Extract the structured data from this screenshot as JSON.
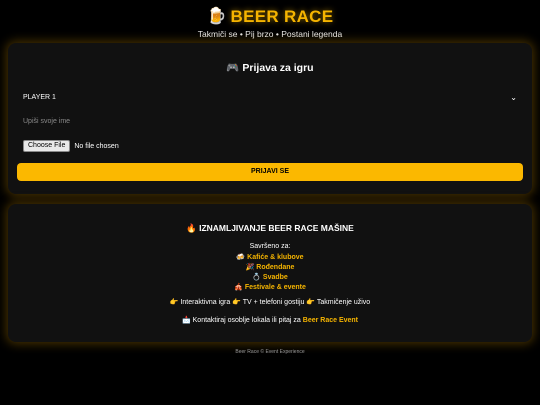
{
  "header": {
    "icon": "beer-mug-icon",
    "title": "BEER RACE",
    "tagline": "Takmiči se • Pij brzo • Postani legenda"
  },
  "registration": {
    "icon": "gamepad-icon",
    "title": "Prijava za igru",
    "player_select_value": "PLAYER 1",
    "name_placeholder": "Upiši svoje ime",
    "file_button": "Choose File",
    "file_status": "No file chosen",
    "submit_label": "PRIJAVI SE"
  },
  "rental": {
    "title": "🔥 IZNAMLJIVANJE BEER RACE MAŠINE",
    "perfect_for": "Savršeno za:",
    "events": [
      {
        "emoji": "🍻",
        "label": "Kafiće & klubove"
      },
      {
        "emoji": "🎉",
        "label": "Rođendane"
      },
      {
        "emoji": "💍",
        "label": "Svadbe"
      },
      {
        "emoji": "🎪",
        "label": "Festivale & evente"
      }
    ],
    "features": "👉 Interaktivna igra 👉 TV + telefoni gostiju 👉 Takmičenje uživo",
    "contact_prefix": "📩 Kontaktiraj osoblje lokala ili pitaj za",
    "contact_highlight": "Beer Race Event"
  },
  "footer": {
    "text": "Beer Race © Event Experience"
  },
  "colors": {
    "accent": "#fbb800",
    "background": "#000000",
    "card": "#111111"
  }
}
